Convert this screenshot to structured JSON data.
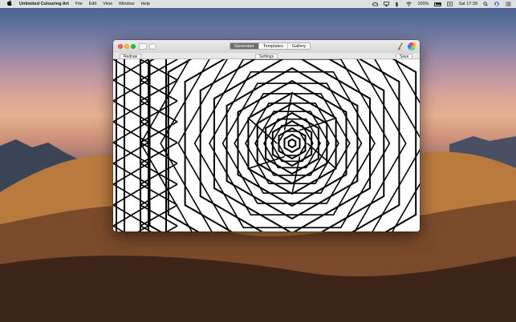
{
  "menubar": {
    "apple": "",
    "app_name": "Unlimited Colouring Art",
    "menus": [
      "File",
      "Edit",
      "View",
      "Window",
      "Help"
    ],
    "battery_percent": "100%",
    "clock": "Sat 17:39",
    "status_icons": [
      "creative-cloud-icon",
      "airplay-icon",
      "bluetooth-icon",
      "wifi-icon",
      "battery-icon",
      "keyboard-input-icon",
      "spotlight-icon",
      "user-icon",
      "notification-center-icon"
    ]
  },
  "window": {
    "tabs": [
      {
        "label": "Generator",
        "active": true
      },
      {
        "label": "Templates",
        "active": false
      },
      {
        "label": "Gallery",
        "active": false
      }
    ],
    "toolbar": {
      "redraw_label": "Redraw",
      "settings_label": "Settings",
      "save_label": "Save"
    },
    "tools": [
      "brush-icon",
      "color-wheel-icon"
    ]
  },
  "colors": {
    "close": "#ff5f57",
    "minimize": "#ffbd2e",
    "maximize": "#28c940",
    "active_tab": "#6d6d6d",
    "line_art": "#000000"
  }
}
